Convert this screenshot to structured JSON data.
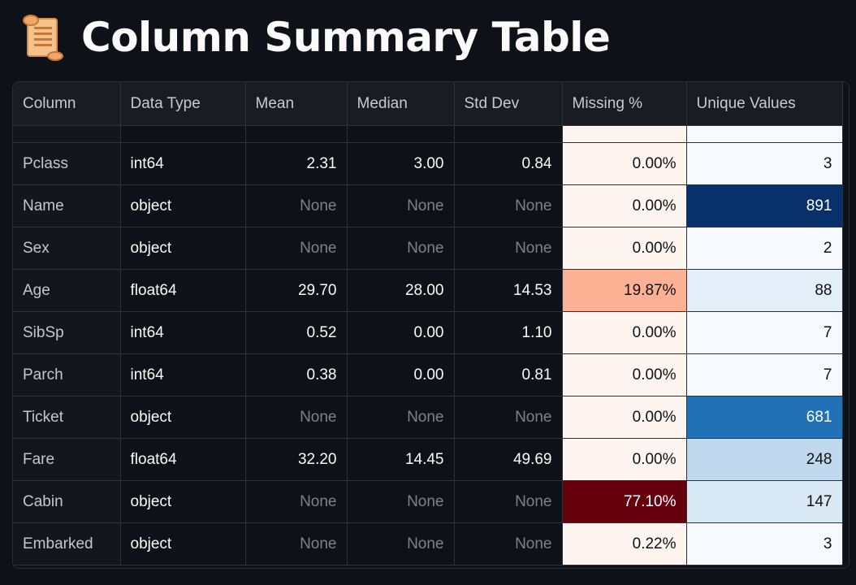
{
  "header": {
    "title": "Column Summary Table",
    "icon": "scroll-icon"
  },
  "table": {
    "columns": [
      "Column",
      "Data Type",
      "Mean",
      "Median",
      "Std Dev",
      "Missing %",
      "Unique Values"
    ],
    "rows": [
      {
        "col": "Pclass",
        "type": "int64",
        "mean": "2.31",
        "median": "3.00",
        "std": "0.84",
        "missing": "0.00%",
        "unique": "3",
        "missing_bg": "#fff5f0",
        "missing_fg": "#111111",
        "unique_bg": "#f6faff",
        "unique_fg": "#111111"
      },
      {
        "col": "Name",
        "type": "object",
        "mean": "None",
        "median": "None",
        "std": "None",
        "missing": "0.00%",
        "unique": "891",
        "missing_bg": "#fff5f0",
        "missing_fg": "#111111",
        "unique_bg": "#08306b",
        "unique_fg": "#ffffff"
      },
      {
        "col": "Sex",
        "type": "object",
        "mean": "None",
        "median": "None",
        "std": "None",
        "missing": "0.00%",
        "unique": "2",
        "missing_bg": "#fff5f0",
        "missing_fg": "#111111",
        "unique_bg": "#f7fbff",
        "unique_fg": "#111111"
      },
      {
        "col": "Age",
        "type": "float64",
        "mean": "29.70",
        "median": "28.00",
        "std": "14.53",
        "missing": "19.87%",
        "unique": "88",
        "missing_bg": "#fcb195",
        "missing_fg": "#111111",
        "unique_bg": "#e3eef9",
        "unique_fg": "#111111"
      },
      {
        "col": "SibSp",
        "type": "int64",
        "mean": "0.52",
        "median": "0.00",
        "std": "1.10",
        "missing": "0.00%",
        "unique": "7",
        "missing_bg": "#fff5f0",
        "missing_fg": "#111111",
        "unique_bg": "#f6faff",
        "unique_fg": "#111111"
      },
      {
        "col": "Parch",
        "type": "int64",
        "mean": "0.38",
        "median": "0.00",
        "std": "0.81",
        "missing": "0.00%",
        "unique": "7",
        "missing_bg": "#fff5f0",
        "missing_fg": "#111111",
        "unique_bg": "#f6faff",
        "unique_fg": "#111111"
      },
      {
        "col": "Ticket",
        "type": "object",
        "mean": "None",
        "median": "None",
        "std": "None",
        "missing": "0.00%",
        "unique": "681",
        "missing_bg": "#fff5f0",
        "missing_fg": "#111111",
        "unique_bg": "#2270b5",
        "unique_fg": "#ffffff"
      },
      {
        "col": "Fare",
        "type": "float64",
        "mean": "32.20",
        "median": "14.45",
        "std": "49.69",
        "missing": "0.00%",
        "unique": "248",
        "missing_bg": "#fff5f0",
        "missing_fg": "#111111",
        "unique_bg": "#bfd8ed",
        "unique_fg": "#111111"
      },
      {
        "col": "Cabin",
        "type": "object",
        "mean": "None",
        "median": "None",
        "std": "None",
        "missing": "77.10%",
        "unique": "147",
        "missing_bg": "#67000d",
        "missing_fg": "#ffffff",
        "unique_bg": "#d9e8f5",
        "unique_fg": "#111111"
      },
      {
        "col": "Embarked",
        "type": "object",
        "mean": "None",
        "median": "None",
        "std": "None",
        "missing": "0.22%",
        "unique": "3",
        "missing_bg": "#fff4ef",
        "missing_fg": "#111111",
        "unique_bg": "#f6faff",
        "unique_fg": "#111111"
      }
    ]
  }
}
